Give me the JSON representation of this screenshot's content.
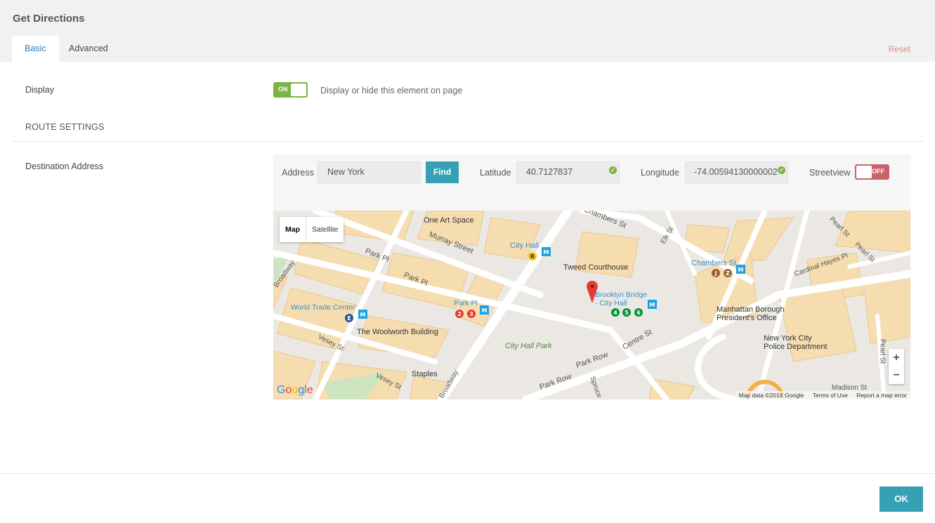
{
  "dialog": {
    "title": "Get Directions"
  },
  "tabs": [
    {
      "label": "Basic"
    },
    {
      "label": "Advanced"
    }
  ],
  "reset_label": "Reset",
  "display": {
    "label": "Display",
    "toggle_text": "ON",
    "help": "Display or hide this element on page"
  },
  "route_settings": {
    "heading": "ROUTE SETTINGS"
  },
  "destination": {
    "label": "Destination Address",
    "address_label": "Address",
    "address_value": "New York",
    "find_label": "Find",
    "latitude_label": "Latitude",
    "latitude_value": "40.7127837",
    "longitude_label": "Longitude",
    "longitude_value": "-74.00594130000002",
    "streetview_label": "Streetview",
    "streetview_toggle_text": "OFF"
  },
  "map": {
    "type_map": "Map",
    "type_satellite": "Satellite",
    "zoom_in": "+",
    "zoom_out": "−",
    "attribution": "Map data ©2016 Google",
    "terms": "Terms of Use",
    "report": "Report a map error",
    "labels": {
      "one_art_space": "One Art Space",
      "murray_street": "Murray Street",
      "city_hall_station": "City Hall",
      "tweed_courthouse": "Tweed Courthouse",
      "chambers_st": "Chambers St",
      "brooklyn_bridge": "Brooklyn Bridge\n- City Hall",
      "park_pl": "Park Pl",
      "park_pl_2": "Park Pl",
      "park_pl_station": "Park Pl",
      "world_trade_center": "World Trade Center",
      "woolworth": "The Woolworth Building",
      "city_hall_park": "City Hall Park",
      "manhattan_borough": "Manhattan Borough\nPresident's Office",
      "nypd": "New York City\nPolice Department",
      "staples": "Staples",
      "vesey_st": "Vesey St",
      "vesey_st_2": "Vesey St",
      "park_row": "Park Row",
      "park_row_2": "Park Row",
      "centre_st": "Centre St",
      "cardinal_hayes": "Cardinal Hayes Pl",
      "pearl_st": "Pearl St",
      "pearl_st_2": "Pearl St",
      "elk_st": "Elk St",
      "chambers_st_road": "Chambers St",
      "broadway": "Broadway",
      "broadway_2": "Broadway",
      "spruce": "Spruce",
      "pearl_st_vertical": "Pearl St",
      "madison_st": "Madison St"
    }
  },
  "ok_label": "OK",
  "colors": {
    "accent": "#36a1b5",
    "toggle_on": "#7cb342",
    "toggle_off": "#c9636a",
    "reset": "#e08677"
  }
}
